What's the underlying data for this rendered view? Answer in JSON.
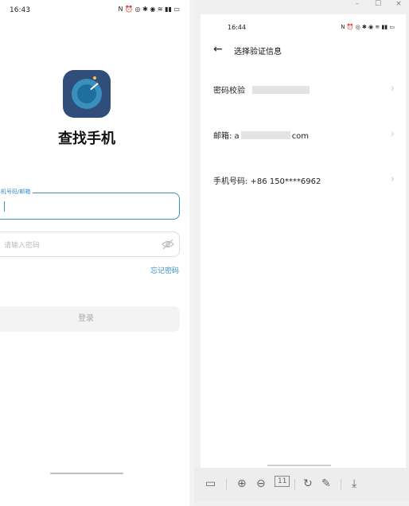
{
  "left_phone": {
    "status_time": "16:43",
    "app_title": "查找手机",
    "phone_label": "手机号码/邮箱",
    "password_placeholder": "请输入密码",
    "forgot_password": "忘记密码",
    "login_button": "登录",
    "icon_colors": {
      "bg": "#2f4e79",
      "ring": "#3a8fbd",
      "accent": "#3a8fc7"
    }
  },
  "window": {
    "minimize": "–",
    "maximize": "☐",
    "close": "×"
  },
  "right_phone": {
    "status_time": "16:44",
    "title": "选择验证信息",
    "options": [
      {
        "label": "密码校验"
      },
      {
        "label_prefix": "邮箱: a",
        "label_suffix": "com"
      },
      {
        "label": "手机号码: +86 150****6962"
      }
    ]
  },
  "toolbar": {
    "zoom_level": "11"
  }
}
